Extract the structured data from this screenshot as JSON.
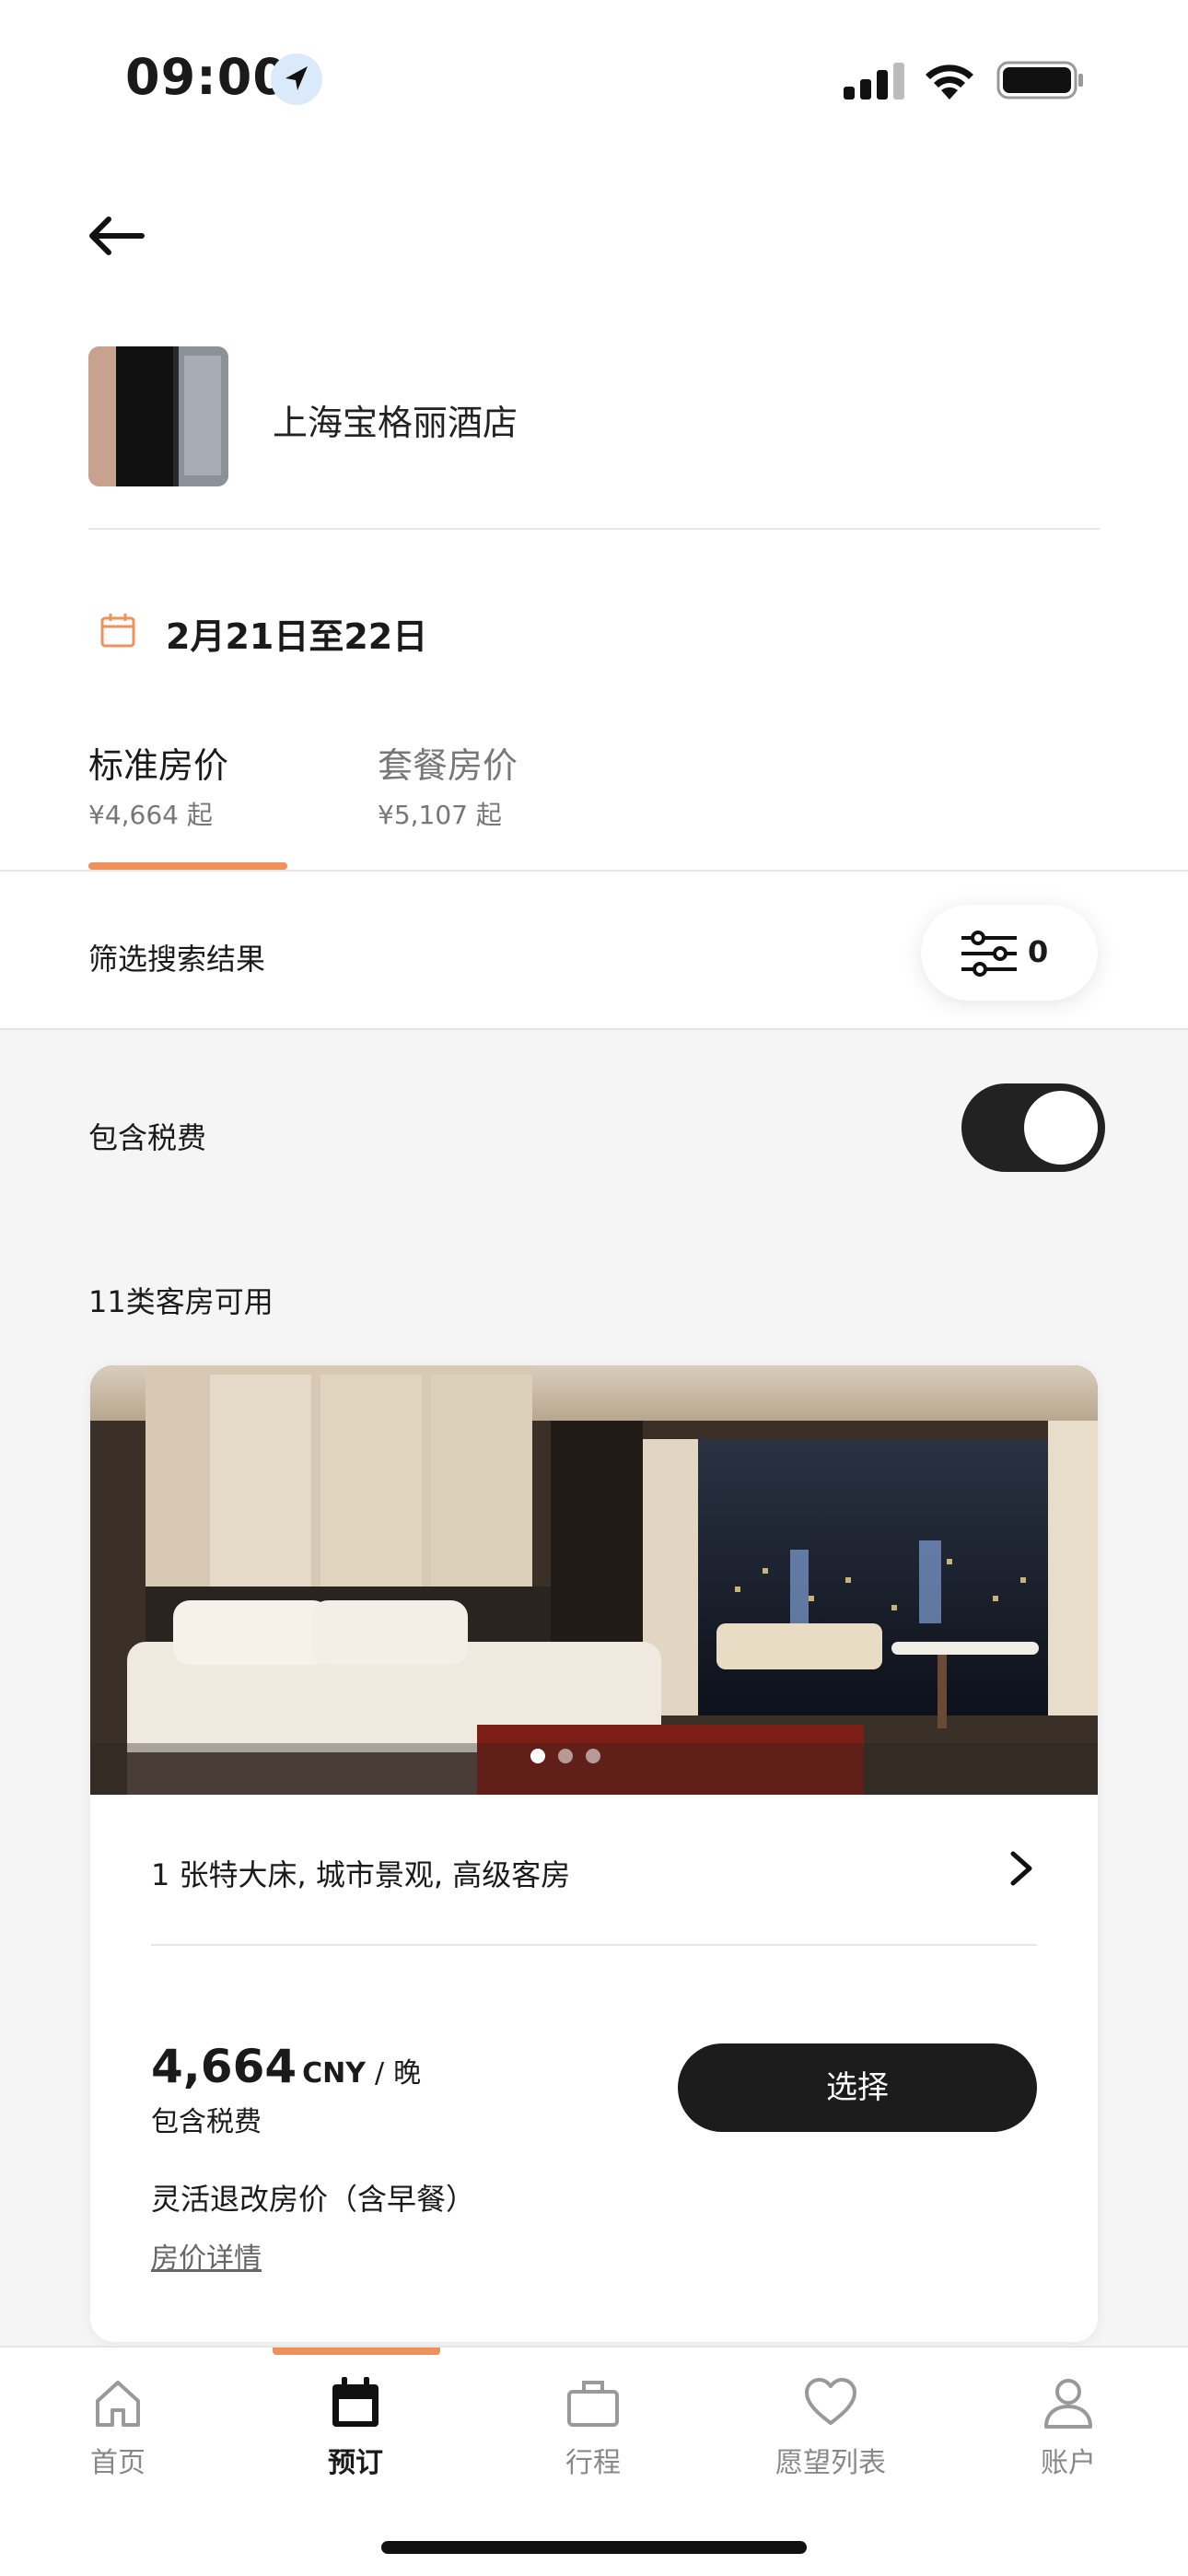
{
  "status_bar": {
    "time": "09:00"
  },
  "hotel": {
    "name": "上海宝格丽酒店"
  },
  "booking": {
    "dates": "2月21日至22日"
  },
  "tabs": [
    {
      "title": "标准房价",
      "subtitle": "¥4,664 起",
      "active": true
    },
    {
      "title": "套餐房价",
      "subtitle": "¥5,107 起",
      "active": false
    }
  ],
  "filter": {
    "label": "筛选搜索结果",
    "count": "0"
  },
  "tax_toggle": {
    "label": "包含税费",
    "on": true
  },
  "rooms_available": "11类客房可用",
  "room_card": {
    "name": "1 张特大床, 城市景观, 高级客房",
    "photo_count": 3,
    "active_photo": 1,
    "price_amount": "4,664",
    "currency": "CNY",
    "separator": "/",
    "unit": "晚",
    "tax_note": "包含税费",
    "select_label": "选择",
    "rate_name": "灵活退改房价（含早餐）",
    "rate_details": "房价详情"
  },
  "bottom_nav": [
    {
      "label": "首页",
      "icon": "home-icon",
      "active": false
    },
    {
      "label": "预订",
      "icon": "calendar-icon",
      "active": true
    },
    {
      "label": "行程",
      "icon": "briefcase-icon",
      "active": false
    },
    {
      "label": "愿望列表",
      "icon": "heart-icon",
      "active": false
    },
    {
      "label": "账户",
      "icon": "user-icon",
      "active": false
    }
  ],
  "colors": {
    "accent": "#f0905a",
    "dark": "#1c1c1c"
  }
}
